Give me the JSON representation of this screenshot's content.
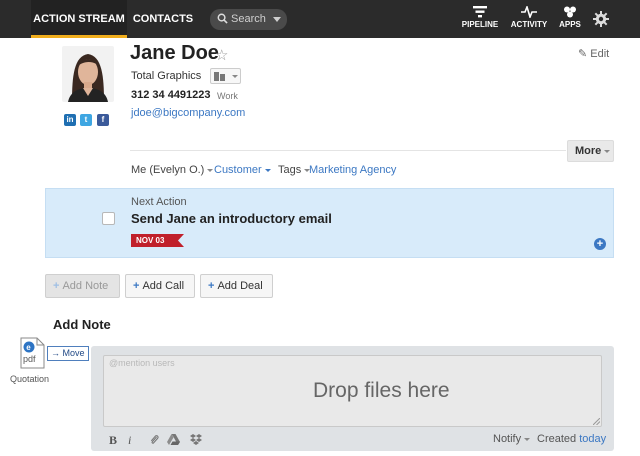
{
  "nav": {
    "action_stream": "ACTION STREAM",
    "contacts": "CONTACTS",
    "search_label": "Search",
    "pipeline": "PIPELINE",
    "activity": "ACTIVITY",
    "apps": "APPS",
    "settings_icon": "gear-icon"
  },
  "contact": {
    "name": "Jane Doe",
    "company": "Total Graphics",
    "phone": "312 34 4491223",
    "phone_type": "Work",
    "email": "jdoe@bigcompany.com",
    "edit_label": "Edit",
    "more_label": "More",
    "social": [
      "in",
      "t",
      "f"
    ]
  },
  "meta": {
    "owner": "Me (Evelyn O.)",
    "type": "Customer",
    "tags_label": "Tags",
    "tag": "Marketing Agency"
  },
  "next_action": {
    "label": "Next Action",
    "title": "Send Jane an introductory email",
    "date": "NOV 03"
  },
  "activity_buttons": {
    "add_note": "Add Note",
    "add_call": "Add Call",
    "add_deal": "Add Deal"
  },
  "composer": {
    "section_title": "Add Note",
    "placeholder": "@mention users",
    "drop_text": "Drop files here",
    "bold": "B",
    "italic": "i",
    "notify": "Notify",
    "created_label": "Created",
    "created_when": "today"
  },
  "drag": {
    "file_label": "Quotation",
    "file_ext": "pdf",
    "move_label": "Move"
  },
  "colors": {
    "accent": "#3c78c3",
    "nav_bg": "#2b2b2b",
    "nav_underline": "#f0ad1c",
    "action_bg": "#d8ebfa",
    "date_tag": "#c0202b"
  }
}
